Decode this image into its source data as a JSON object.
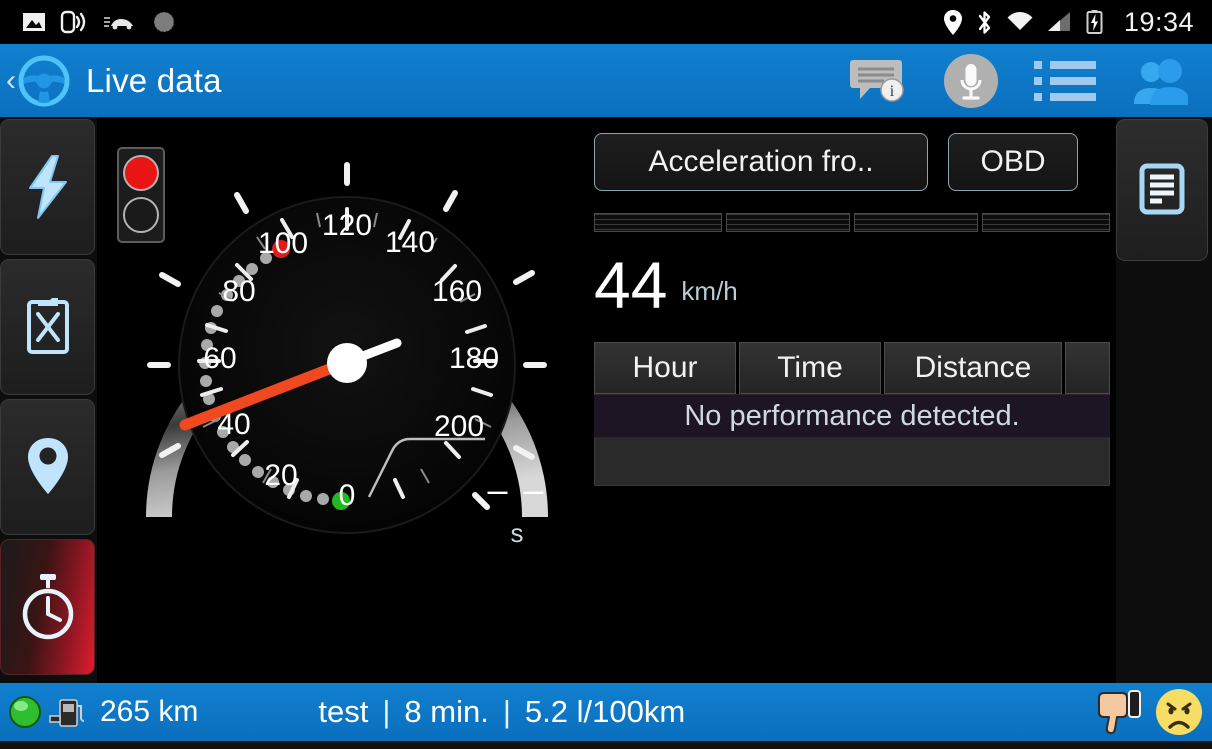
{
  "status_bar": {
    "icons_left": [
      "image-icon",
      "vibrate-icon",
      "car-icon",
      "sync-icon"
    ],
    "icons_right": [
      "location-icon",
      "bluetooth-icon",
      "wifi-icon",
      "signal-icon",
      "battery-charging-icon"
    ],
    "clock": "19:34"
  },
  "title_bar": {
    "back_label": "‹",
    "app_icon": "steering-wheel-icon",
    "title": "Live data",
    "icons": [
      "chat-info-icon",
      "microphone-icon",
      "list-icon",
      "user-icon"
    ]
  },
  "sidebar_left": {
    "items": [
      {
        "icon": "lightning-bolt-icon",
        "active": false
      },
      {
        "icon": "clipboard-x-icon",
        "active": false
      },
      {
        "icon": "location-pin-icon",
        "active": false
      },
      {
        "icon": "stopwatch-icon",
        "active": true
      }
    ]
  },
  "sidebar_right": {
    "items": [
      {
        "icon": "document-report-icon"
      }
    ]
  },
  "gauge": {
    "type": "speedometer",
    "min": 0,
    "max": 220,
    "tick_labels": [
      "0",
      "20",
      "40",
      "60",
      "80",
      "100",
      "120",
      "140",
      "160",
      "180",
      "200"
    ],
    "needle_value": 44,
    "unit": "km/h",
    "peak_marker_value": 105,
    "start_marker_value": 0,
    "traffic_light": {
      "top": "red-on",
      "bottom": "off"
    },
    "timer_value": "– –",
    "timer_unit": "s"
  },
  "panel": {
    "tabs": [
      {
        "label": "Acceleration fro..",
        "name": "acceleration-tab"
      },
      {
        "label": "OBD",
        "name": "obd-tab"
      }
    ],
    "segment_bars": 4,
    "readout": {
      "value": "44",
      "unit": "km/h"
    },
    "table": {
      "headers": [
        "Hour",
        "Time",
        "Distance",
        ""
      ],
      "message": "No performance detected."
    }
  },
  "bottom_bar": {
    "status_icon": "green-ball-icon",
    "fuel_icon": "fuel-pump-icon",
    "range": "265 km",
    "trip_name": "test",
    "separator": "|",
    "duration": "8 min.",
    "consumption": "5.2 l/100km",
    "rating_icons": [
      "thumbs-down-icon",
      "sad-face-icon"
    ]
  },
  "colors": {
    "accent_blue": "#0b74c4",
    "needle": "#f0481f",
    "active_red": "#e01d2c",
    "panel_black": "#000000"
  },
  "chart_data": {
    "type": "gauge",
    "title": "Speed",
    "categories": [
      "0",
      "20",
      "40",
      "60",
      "80",
      "100",
      "120",
      "140",
      "160",
      "180",
      "200"
    ],
    "values": [
      44
    ],
    "ylabel": "km/h",
    "ylim": [
      0,
      220
    ],
    "annotations": [
      "peak marker at 105",
      "start marker at 0"
    ]
  }
}
